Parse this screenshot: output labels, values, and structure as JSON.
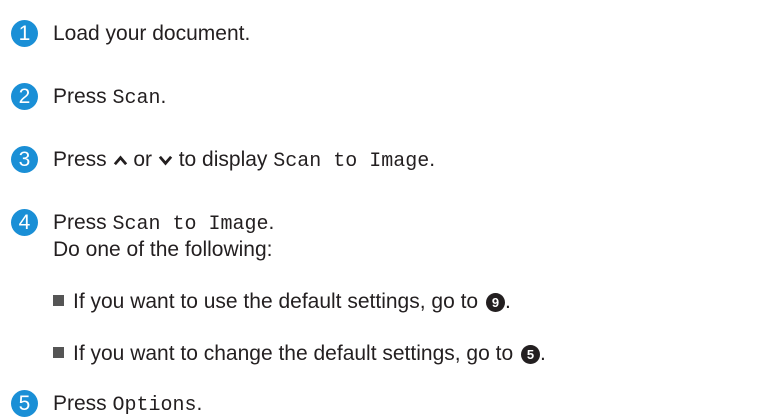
{
  "steps": [
    {
      "num": "1",
      "text": "Load your document."
    },
    {
      "num": "2",
      "prefix": "Press ",
      "code": "Scan",
      "suffix": "."
    },
    {
      "num": "3",
      "prefix": "Press ",
      "mid": " or ",
      "after": " to display ",
      "code": "Scan to Image",
      "suffix": ".",
      "up_icon": "chevron-up-icon",
      "down_icon": "chevron-down-icon"
    },
    {
      "num": "4",
      "prefix": "Press ",
      "code": "Scan to Image",
      "suffix": ".",
      "subtext": "Do one of the following:",
      "bullets": [
        {
          "text": "If you want to use the default settings, go to ",
          "ref": "9",
          "suffix": "."
        },
        {
          "text": "If you want to change the default settings, go to ",
          "ref": "5",
          "suffix": "."
        }
      ]
    },
    {
      "num": "5",
      "prefix": "Press ",
      "code": "Options",
      "suffix": "."
    }
  ],
  "colors": {
    "accent": "#1a8fd6",
    "text": "#231f20"
  }
}
